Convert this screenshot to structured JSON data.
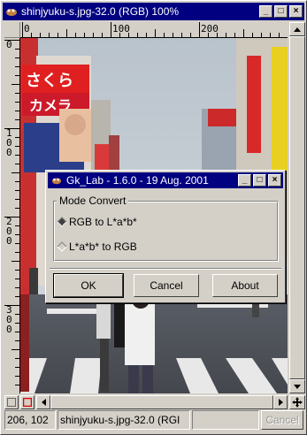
{
  "window": {
    "title": "shinjyuku-s.jpg-32.0 (RGB) 100%",
    "minimize_glyph": "_",
    "maximize_glyph": "□",
    "close_glyph": "×"
  },
  "rulers": {
    "horizontal": [
      "0",
      "100",
      "200"
    ],
    "vertical": [
      "0",
      "1\n0\n0",
      "2\n0\n0",
      "3\n0\n0"
    ]
  },
  "statusbar": {
    "coords": "206, 102",
    "filename": "shinjyuku-s.jpg-32.0 (RGI",
    "cancel_label": "Cancel"
  },
  "dialog": {
    "title": "Gk_Lab - 1.6.0 - 19 Aug. 2001",
    "group_label": "Mode Convert",
    "options": [
      {
        "label": "RGB to L*a*b*",
        "selected": true
      },
      {
        "label": "L*a*b* to RGB",
        "selected": false
      }
    ],
    "buttons": {
      "ok": "OK",
      "cancel": "Cancel",
      "about": "About"
    }
  },
  "photo": {
    "signs": [
      "さくら",
      "カメラ"
    ]
  },
  "colors": {
    "titlebar": "#000080",
    "face": "#d4d0c8"
  }
}
